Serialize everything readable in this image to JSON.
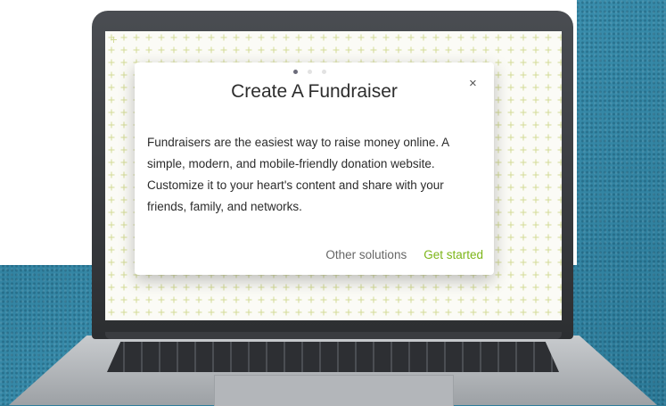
{
  "modal": {
    "title": "Create A Fundraiser",
    "close_label": "×",
    "body": "Fundraisers are the easiest way to raise money online. A simple, modern, and mobile-friendly donation website. Customize it to your heart's content and share with your friends, family, and networks.",
    "secondary_button": "Other solutions",
    "primary_button": "Get started",
    "pagination": {
      "total": 3,
      "current": 1
    }
  },
  "colors": {
    "primary_accent": "#7cb518",
    "background_teal": "#2f7e9c",
    "pattern": "#d6dd9c"
  }
}
